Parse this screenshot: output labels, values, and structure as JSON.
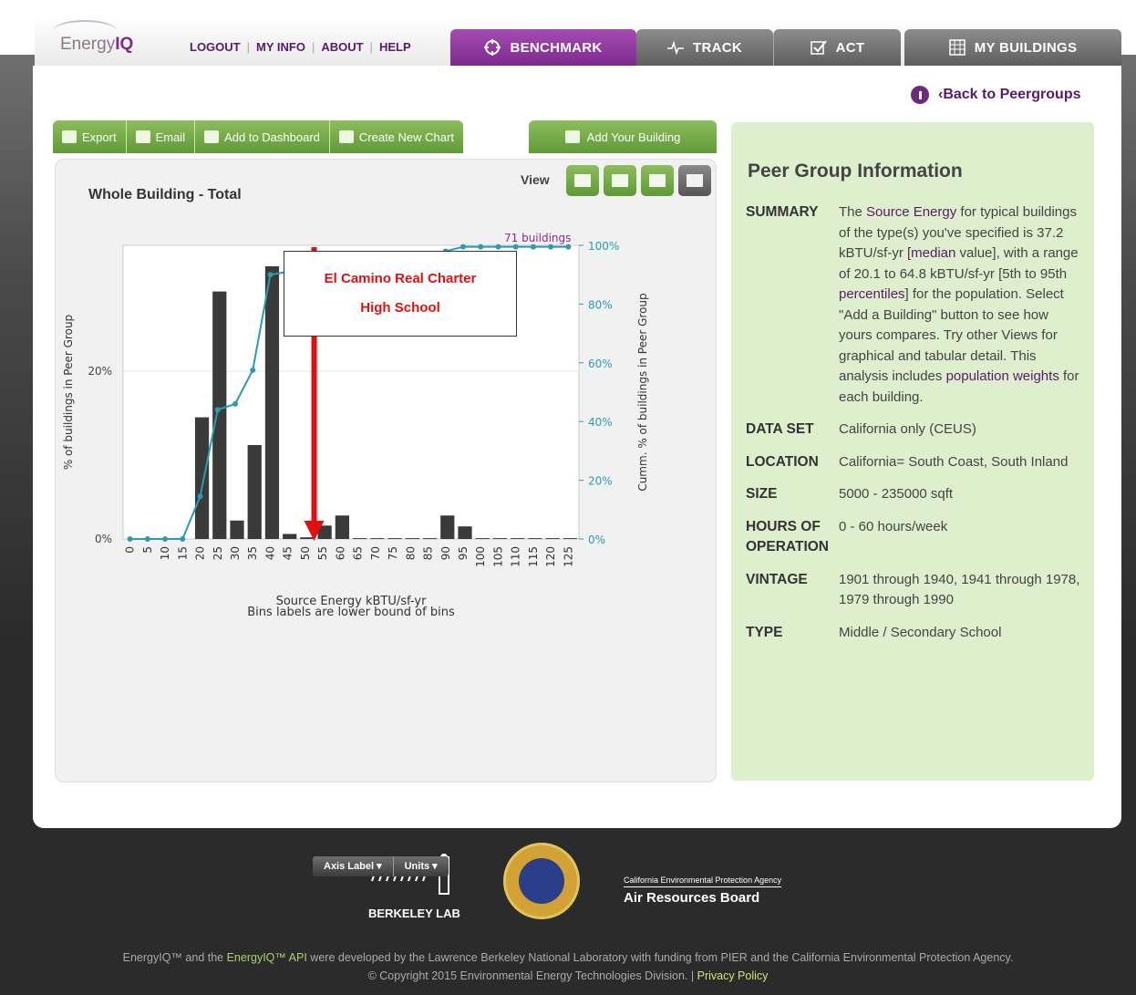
{
  "app": {
    "logo_prefix": "Energy",
    "logo_suffix": "IQ"
  },
  "nav": {
    "links": [
      "LOGOUT",
      "MY INFO",
      "ABOUT",
      "HELP"
    ],
    "tabs": {
      "benchmark": "BENCHMARK",
      "track": "TRACK",
      "act": "ACT",
      "mybuildings": "MY BUILDINGS"
    },
    "active_tab": "BENCHMARK"
  },
  "back_link": "‹Back to Peergroups",
  "toolbar": {
    "export": "Export",
    "email": "Email",
    "add_dashboard": "Add to Dashboard",
    "create_chart": "Create New Chart",
    "add_building": "Add Your Building"
  },
  "chart_panel": {
    "title": "Whole Building - Total",
    "view_label": "View",
    "callout_line1": "El Camino Real Charter",
    "callout_line2": "High School",
    "axis_label_btn": "Axis Label ▾",
    "units_btn": "Units ▾"
  },
  "chart_data": {
    "type": "bar",
    "title": "Whole Building - Total",
    "xlabel": "Source Energy kBTU/sf-yr",
    "xlabel_note": "Bins labels are lower bound of bins",
    "ylabel": "% of buildings in Peer Group",
    "y2label": "Cumm. % of buildings in Peer Group",
    "annotation": "71 buildings",
    "categories": [
      "0",
      "5",
      "10",
      "15",
      "20",
      "25",
      "30",
      "35",
      "40",
      "45",
      "50",
      "55",
      "60",
      "65",
      "70",
      "75",
      "80",
      "85",
      "90",
      "95",
      "100",
      "105",
      "110",
      "115",
      "120",
      "125"
    ],
    "series": [
      {
        "values": [
          0,
          0,
          0,
          0,
          14.5,
          29.5,
          2.2,
          11.2,
          32.5,
          0.6,
          0.2,
          1.6,
          2.8,
          0.1,
          0.1,
          0.1,
          0.1,
          0.1,
          2.8,
          1.5,
          0.1,
          0.1,
          0.1,
          0.1,
          0.1,
          0.1
        ]
      },
      {
        "values": [
          0,
          0,
          0,
          0,
          14.5,
          44,
          46,
          57.5,
          90,
          91,
          91,
          92.5,
          95,
          95,
          95,
          95,
          95,
          95,
          98,
          99.5,
          99.5,
          99.5,
          99.5,
          99.5,
          99.5,
          99.5
        ]
      }
    ],
    "ylim": [
      0,
      35
    ],
    "y_ticks": [
      "0%",
      "20%"
    ],
    "y2lim": [
      0,
      100
    ],
    "y2_ticks": [
      "0%",
      "20%",
      "40%",
      "60%",
      "80%",
      "100%"
    ],
    "marker_value": "55",
    "colors": {
      "bars": "#3a3a3a",
      "line": "#2a9bb0",
      "marker": "#e01010",
      "annotation": "#8a2a9a"
    }
  },
  "info": {
    "title": "Peer Group Information",
    "rows": [
      {
        "k": "SUMMARY",
        "v_pre": "The ",
        "v_hl1": "Source Energy",
        "v_mid": " for typical buildings of the type(s) you've specified is 37.2 kBTU/sf-yr ",
        "v_hl2": "[median",
        "v_mid2": " value], with a range of 20.1 to 64.8 kBTU/sf-yr [5th to 95th ",
        "v_hl3": "percentiles",
        "v_mid3": "] for the population. Select \"Add a Building\" button to see how yours compares. Try other Views for graphical and tabular detail. This analysis includes ",
        "v_hl4": "population weights",
        "v_end": " for each building."
      },
      {
        "k": "DATA SET",
        "v": "California only (CEUS)"
      },
      {
        "k": "LOCATION",
        "v": "California= South Coast, South Inland"
      },
      {
        "k": "SIZE",
        "v": "5000 - 235000 sqft"
      },
      {
        "k": "HOURS OF OPERATION",
        "v": "0 - 60 hours/week"
      },
      {
        "k": "VINTAGE",
        "v": "1901 through 1940, 1941 through 1978, 1979 through 1990"
      },
      {
        "k": "TYPE",
        "v": "Middle / Secondary School"
      }
    ]
  },
  "footer": {
    "berkeley": "BERKELEY LAB",
    "arb_small": "California Environmental Protection Agency",
    "arb_big": "Air Resources Board",
    "line1_a": "EnergyIQ™ and the ",
    "line1_link": "EnergyIQ™ API",
    "line1_b": " were developed by the Lawrence Berkeley National Laboratory with funding from PIER and the California Environmental Protection Agency.",
    "line2_a": "© Copyright 2015 Environmental Energy Technologies Division. | ",
    "line2_link": "Privacy Policy"
  }
}
